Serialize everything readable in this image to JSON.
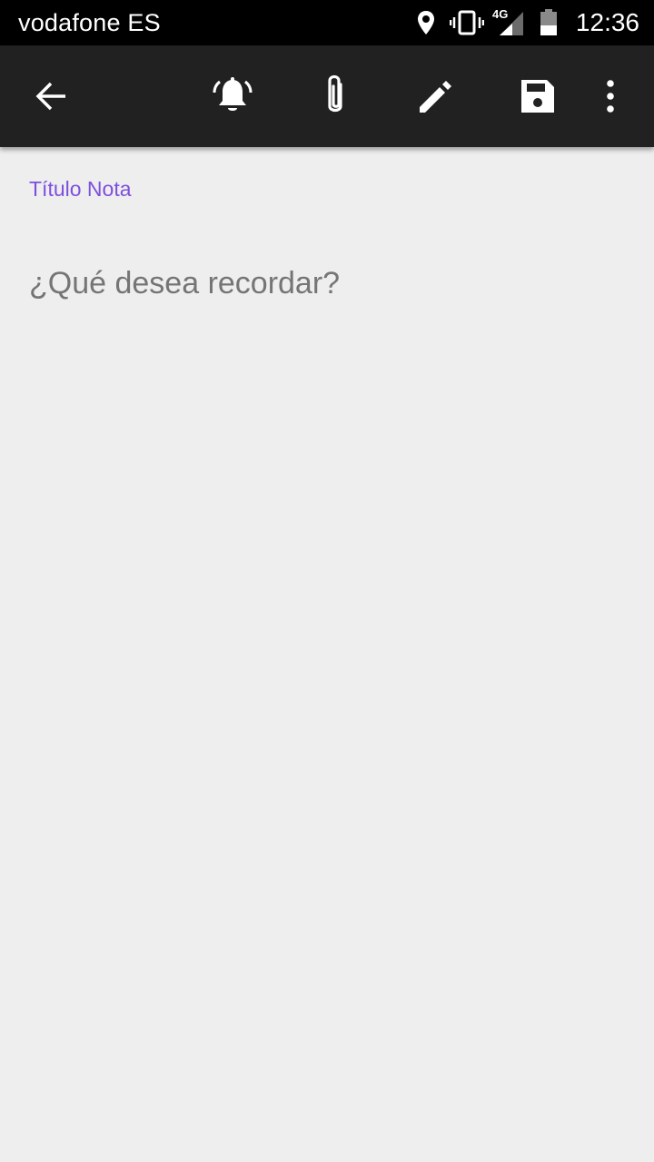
{
  "status_bar": {
    "carrier": "vodafone ES",
    "network_type": "4G",
    "time": "12:36",
    "icons": [
      "location-icon",
      "vibrate-icon",
      "signal-icon",
      "battery-icon"
    ]
  },
  "toolbar": {
    "icons": [
      "back-arrow-icon",
      "alarm-bell-icon",
      "attachment-icon",
      "edit-pencil-icon",
      "save-icon",
      "more-vertical-icon"
    ]
  },
  "note": {
    "title_label": "Título Nota",
    "body_placeholder": "¿Qué desea recordar?"
  },
  "colors": {
    "toolbar_bg": "#212121",
    "page_bg": "#eeeeee",
    "title_accent": "#7e4fdf",
    "placeholder_text": "#757575"
  }
}
